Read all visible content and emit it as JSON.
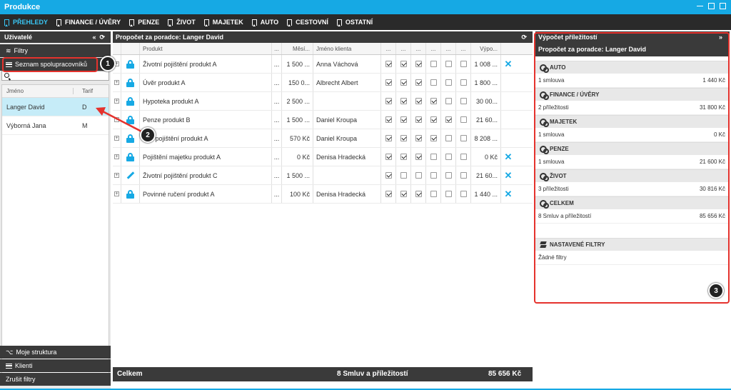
{
  "window": {
    "title": "Produkce"
  },
  "nav": [
    {
      "label": "PŘEHLEDY",
      "active": true
    },
    {
      "label": "FINANCE / ÚVĚRY"
    },
    {
      "label": "PENZE"
    },
    {
      "label": "ŽIVOT"
    },
    {
      "label": "MAJETEK"
    },
    {
      "label": "AUTO"
    },
    {
      "label": "CESTOVNÍ"
    },
    {
      "label": "OSTATNÍ"
    }
  ],
  "left": {
    "header": "Uživatelé",
    "filters": "Filtry",
    "coworkers": "Seznam spolupracovníků",
    "col_name": "Jméno",
    "col_tariff": "Tarif",
    "users": [
      {
        "name": "Langer David",
        "tariff": "D",
        "selected": true
      },
      {
        "name": "Výborná Jana",
        "tariff": "M"
      }
    ],
    "my_structure": "Moje struktura",
    "clients": "Klienti",
    "clear_filters": "Zrušit filtry"
  },
  "center": {
    "header": "Propočet za poradce: Langer David",
    "cols": {
      "product": "Produkt",
      "dots": "...",
      "monthly": "Měsí...",
      "client": "Jméno klienta",
      "calc": "Výpo..."
    },
    "rows": [
      {
        "icon": "lock",
        "product": "Životní pojištění produkt A",
        "dots": "...",
        "monthly": "1 500 ...",
        "client": "Anna Váchová",
        "checks": [
          1,
          1,
          1,
          0,
          0,
          0
        ],
        "calc": "1 008 ...",
        "x": true
      },
      {
        "icon": "lock",
        "product": "Úvěr produkt A",
        "dots": "...",
        "monthly": "150 0...",
        "client": "Albrecht Albert",
        "checks": [
          1,
          1,
          1,
          0,
          0,
          0
        ],
        "calc": "1 800 ...",
        "x": false
      },
      {
        "icon": "lock",
        "product": "Hypoteka produkt A",
        "dots": "...",
        "monthly": "2 500 ...",
        "client": "",
        "checks": [
          1,
          1,
          1,
          1,
          0,
          0
        ],
        "calc": "30 00...",
        "x": false
      },
      {
        "icon": "lock",
        "product": "Penze produkt B",
        "dots": "...",
        "monthly": "1 500 ...",
        "client": "Daniel Kroupa",
        "checks": [
          1,
          1,
          1,
          1,
          1,
          0
        ],
        "calc": "21 60...",
        "x": false
      },
      {
        "icon": "lock",
        "product": "...ní pojištění produkt A",
        "dots": "...",
        "monthly": "570 Kč",
        "client": "Daniel Kroupa",
        "checks": [
          1,
          1,
          1,
          1,
          0,
          0
        ],
        "calc": "8 208 ...",
        "x": false
      },
      {
        "icon": "lock",
        "product": "Pojištění majetku produkt A",
        "dots": "...",
        "monthly": "0 Kč",
        "client": "Denisa Hradecká",
        "checks": [
          1,
          1,
          1,
          0,
          0,
          0
        ],
        "calc": "0 Kč",
        "x": true
      },
      {
        "icon": "pencil",
        "product": "Životní pojištění produkt C",
        "dots": "...",
        "monthly": "1 500 ...",
        "client": "",
        "checks": [
          1,
          0,
          0,
          0,
          0,
          0
        ],
        "calc": "21 60...",
        "x": true
      },
      {
        "icon": "lock",
        "product": "Povinné ručení produkt A",
        "dots": "...",
        "monthly": "100 Kč",
        "client": "Denisa Hradecká",
        "checks": [
          1,
          1,
          1,
          0,
          0,
          0
        ],
        "calc": "1 440 ...",
        "x": true
      }
    ],
    "footer": {
      "label": "Celkem",
      "count": "8 Smluv a příležitostí",
      "total": "85 656 Kč"
    }
  },
  "right": {
    "header": "Výpočet příležitostí",
    "subheader": "Propočet za poradce: Langer David",
    "sections": [
      {
        "title": "AUTO",
        "desc": "1 smlouva",
        "value": "1 440 Kč"
      },
      {
        "title": "FINANCE / ÚVĚRY",
        "desc": "2 příležitosti",
        "value": "31 800 Kč"
      },
      {
        "title": "MAJETEK",
        "desc": "1 smlouva",
        "value": "0 Kč"
      },
      {
        "title": "PENZE",
        "desc": "1 smlouva",
        "value": "21 600 Kč"
      },
      {
        "title": "ŽIVOT",
        "desc": "3 příležitosti",
        "value": "30 816 Kč"
      },
      {
        "title": "CELKEM",
        "desc": "8 Smluv a příležitostí",
        "value": "85 656 Kč"
      }
    ],
    "filters_title": "NASTAVENÉ FILTRY",
    "filters_value": "Žádné filtry"
  },
  "callouts": [
    "1",
    "2",
    "3"
  ],
  "colors": {
    "accent": "#16a9e4",
    "annotation": "#e5322d"
  }
}
